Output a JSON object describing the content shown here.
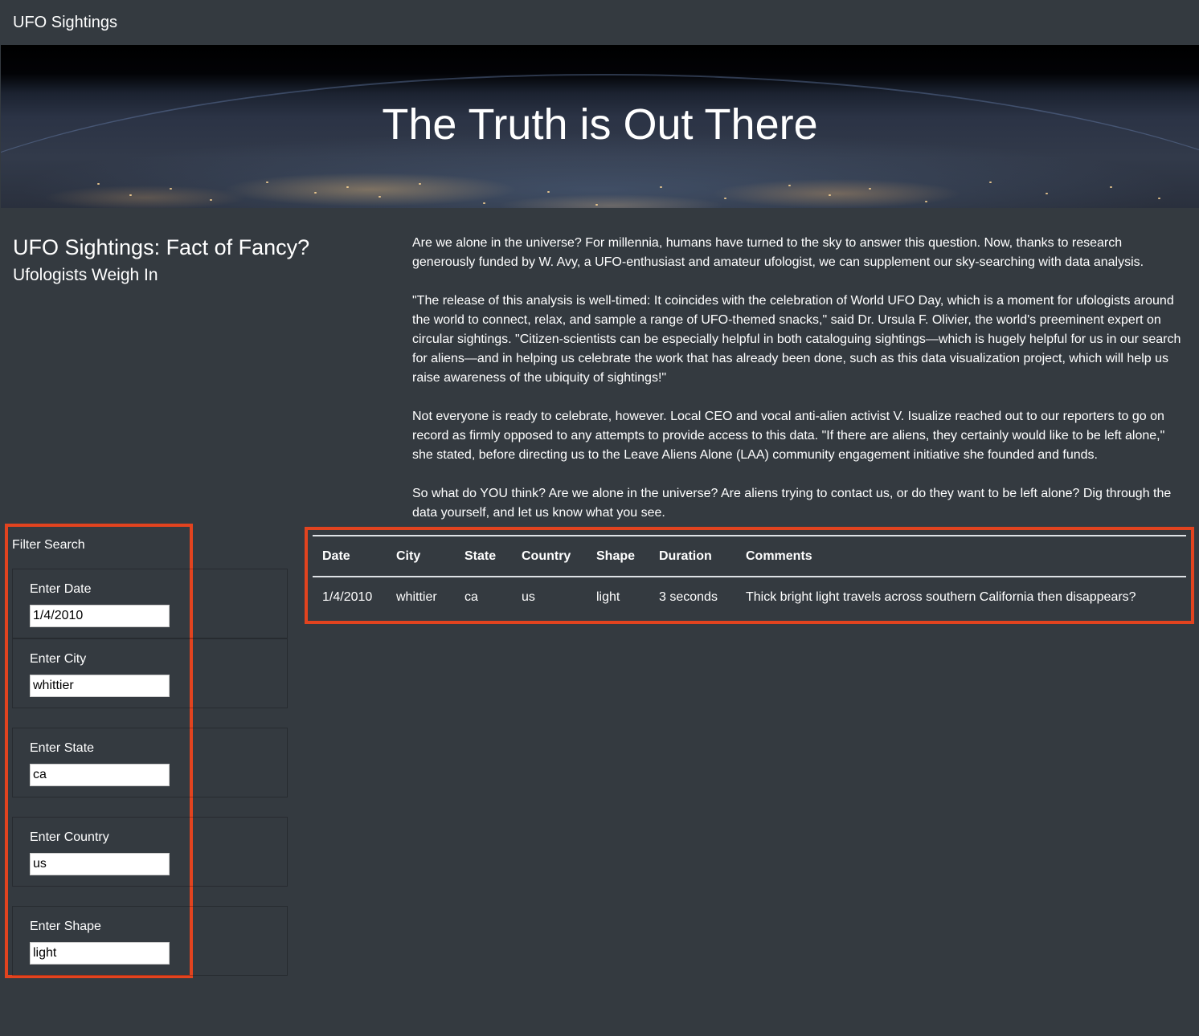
{
  "navbar": {
    "brand": "UFO Sightings"
  },
  "hero": {
    "title": "The Truth is Out There"
  },
  "intro": {
    "title": "UFO Sightings: Fact of Fancy?",
    "subtitle": "Ufologists Weigh In"
  },
  "article": {
    "paragraphs": [
      "Are we alone in the universe? For millennia, humans have turned to the sky to answer this question. Now, thanks to research generously funded by W. Avy, a UFO-enthusiast and amateur ufologist, we can supplement our sky-searching with data analysis.",
      "\"The release of this analysis is well-timed: It coincides with the celebration of World UFO Day, which is a moment for ufologists around the world to connect, relax, and sample a range of UFO-themed snacks,\" said Dr. Ursula F. Olivier, the world's preeminent expert on circular sightings. \"Citizen-scientists can be especially helpful in both cataloguing sightings—which is hugely helpful for us in our search for aliens—and in helping us celebrate the work that has already been done, such as this data visualization project, which will help us raise awareness of the ubiquity of sightings!\"",
      "Not everyone is ready to celebrate, however. Local CEO and vocal anti-alien activist V. Isualize reached out to our reporters to go on record as firmly opposed to any attempts to provide access to this data. \"If there are aliens, they certainly would like to be left alone,\" she stated, before directing us to the Leave Aliens Alone (LAA) community engagement initiative she founded and funds.",
      "So what do YOU think? Are we alone in the universe? Are aliens trying to contact us, or do they want to be left alone? Dig through the data yourself, and let us know what you see."
    ]
  },
  "filters": {
    "title": "Filter Search",
    "items": [
      {
        "label": "Enter Date",
        "value": "1/4/2010"
      },
      {
        "label": "Enter City",
        "value": "whittier"
      },
      {
        "label": "Enter State",
        "value": "ca"
      },
      {
        "label": "Enter Country",
        "value": "us"
      },
      {
        "label": "Enter Shape",
        "value": "light"
      }
    ]
  },
  "table": {
    "headers": [
      "Date",
      "City",
      "State",
      "Country",
      "Shape",
      "Duration",
      "Comments"
    ],
    "rows": [
      [
        "1/4/2010",
        "whittier",
        "ca",
        "us",
        "light",
        "3 seconds",
        "Thick bright light travels across southern California then disappears?"
      ]
    ]
  },
  "colors": {
    "background": "#343a40",
    "highlight": "#e2431f",
    "text": "#ffffff"
  }
}
